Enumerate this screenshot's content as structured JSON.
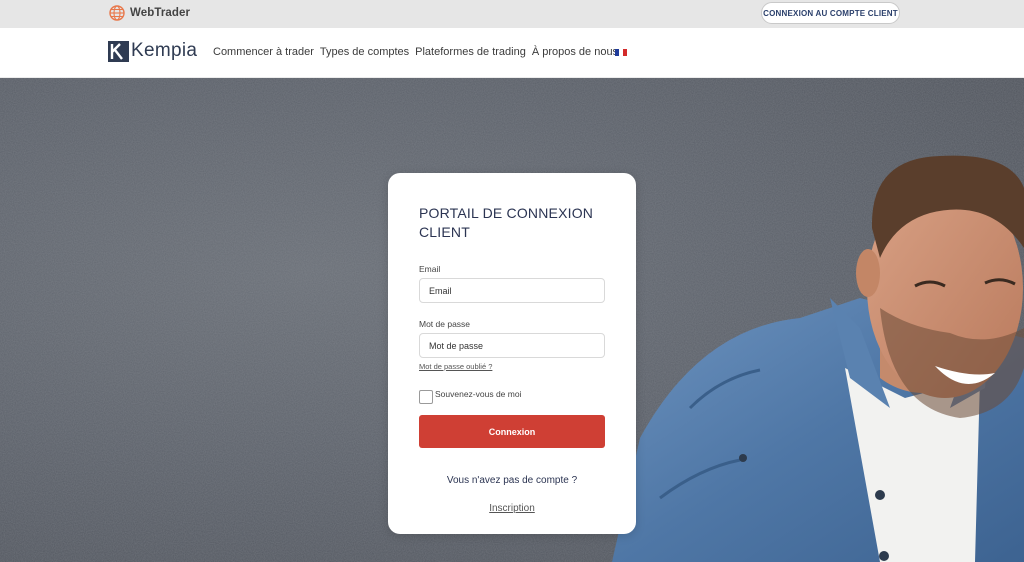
{
  "topbar": {
    "webtrader_label": "WebTrader",
    "client_login_button": "CONNEXION AU COMPTE CLIENT"
  },
  "nav": {
    "brand": "Kempia",
    "links": [
      "Commencer à trader",
      "Types de comptes",
      "Plateformes de trading",
      "À propos de nous"
    ],
    "language_flag": "fr-flag-icon"
  },
  "login": {
    "title": "PORTAIL DE CONNEXION CLIENT",
    "email_label": "Email",
    "email_placeholder": "Email",
    "password_label": "Mot de passe",
    "password_placeholder": "Mot de passe",
    "forgot_link": "Mot de passe oublié ?",
    "remember_label": "Souvenez-vous de moi",
    "remember_checked": false,
    "submit_label": "Connexion",
    "no_account_text": "Vous n'avez pas de compte ?",
    "signup_link": "Inscription"
  },
  "colors": {
    "accent_red": "#cf3f34",
    "brand_navy": "#2b3452",
    "topbar_bg": "#e6e6e6",
    "globe_orange": "#e8774a"
  }
}
